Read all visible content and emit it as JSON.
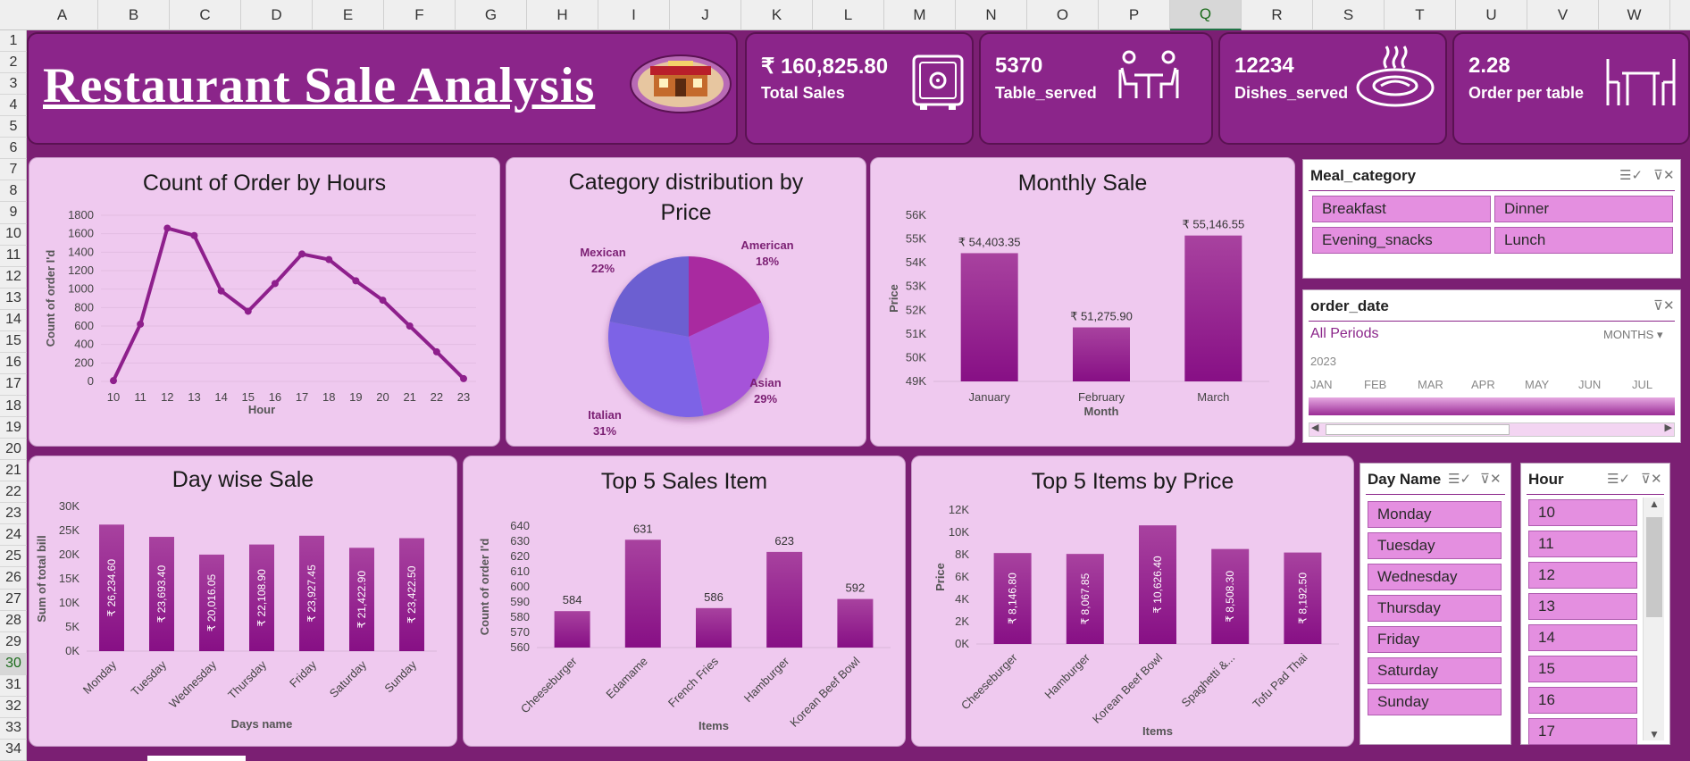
{
  "sheet": {
    "columns": [
      "A",
      "B",
      "C",
      "D",
      "E",
      "F",
      "G",
      "H",
      "I",
      "J",
      "K",
      "L",
      "M",
      "N",
      "O",
      "P",
      "Q",
      "R",
      "S",
      "T",
      "U",
      "V",
      "W"
    ],
    "rows": [
      "1",
      "2",
      "3",
      "4",
      "5",
      "6",
      "7",
      "8",
      "9",
      "10",
      "11",
      "12",
      "13",
      "14",
      "15",
      "16",
      "17",
      "18",
      "19",
      "20",
      "21",
      "22",
      "23",
      "24",
      "25",
      "26",
      "27",
      "28",
      "29",
      "30",
      "31",
      "32",
      "33",
      "34"
    ],
    "selected_column": "Q",
    "selected_row": "30"
  },
  "header": {
    "title": "Restaurant  Sale  Analysis",
    "logo_icon": "restaurant-icon"
  },
  "kpis": [
    {
      "value": "₹ 160,825.80",
      "label": "Total Sales",
      "icon": "safe-icon"
    },
    {
      "value": "5370",
      "label": "Table_served",
      "icon": "dining-table-people-icon"
    },
    {
      "value": "12234",
      "label": "Dishes_served",
      "icon": "hot-dish-icon"
    },
    {
      "value": "2.28",
      "label": "Order per table",
      "icon": "table-chairs-icon"
    }
  ],
  "charts": {
    "hours": {
      "title": "Count of Order by Hours",
      "xlabel": "Hour",
      "ylabel": "Count of order I'd",
      "yticks": [
        "1800",
        "1600",
        "1400",
        "1200",
        "1000",
        "800",
        "600",
        "400",
        "200",
        "0"
      ]
    },
    "category": {
      "title_line1": "Category distribution by",
      "title_line2": "Price",
      "labels": [
        {
          "name": "American",
          "pct": "18%"
        },
        {
          "name": "Asian",
          "pct": "29%"
        },
        {
          "name": "Italian",
          "pct": "31%"
        },
        {
          "name": "Mexican",
          "pct": "22%"
        }
      ]
    },
    "monthly": {
      "title": "Monthly Sale",
      "xlabel": "Month",
      "ylabel": "Price",
      "yticks": [
        "56K",
        "55K",
        "54K",
        "53K",
        "52K",
        "51K",
        "50K",
        "49K"
      ],
      "value_labels": [
        "₹ 54,403.35",
        "₹ 51,275.90",
        "₹ 55,146.55"
      ]
    },
    "daywise": {
      "title": "Day wise Sale",
      "xlabel": "Days name",
      "ylabel": "Sum of total bill",
      "yticks": [
        "30K",
        "25K",
        "20K",
        "15K",
        "10K",
        "5K",
        "0K"
      ],
      "value_labels": [
        "₹ 26,234.60",
        "₹ 23,693.40",
        "₹ 20,016.05",
        "₹ 22,108.90",
        "₹ 23,927.45",
        "₹ 21,422.90",
        "₹ 23,422.50"
      ]
    },
    "top5sales": {
      "title": "Top 5 Sales Item",
      "xlabel": "Items",
      "ylabel": "Count of order I'd",
      "yticks": [
        "640",
        "630",
        "620",
        "610",
        "600",
        "590",
        "580",
        "570",
        "560"
      ],
      "value_labels": [
        "584",
        "631",
        "586",
        "623",
        "592"
      ]
    },
    "top5price": {
      "title": "Top 5 Items by Price",
      "xlabel": "Items",
      "ylabel": "Price",
      "yticks": [
        "12K",
        "10K",
        "8K",
        "6K",
        "4K",
        "2K",
        "0K"
      ],
      "value_labels": [
        "₹ 8,146.80",
        "₹ 8,067.85",
        "₹ 10,626.40",
        "₹ 8,508.30",
        "₹ 8,192.50"
      ]
    }
  },
  "chart_data": [
    {
      "type": "line",
      "title": "Count of Order by Hours",
      "xlabel": "Hour",
      "ylabel": "Count of order I'd",
      "x": [
        10,
        11,
        12,
        13,
        14,
        15,
        16,
        17,
        18,
        19,
        20,
        21,
        22,
        23
      ],
      "y": [
        8,
        620,
        1660,
        1580,
        980,
        760,
        1060,
        1380,
        1320,
        1090,
        880,
        600,
        320,
        30
      ],
      "ylim": [
        0,
        1800
      ],
      "grid": true
    },
    {
      "type": "pie",
      "title": "Category distribution by Price",
      "categories": [
        "American",
        "Asian",
        "Italian",
        "Mexican"
      ],
      "values": [
        18,
        29,
        31,
        22
      ]
    },
    {
      "type": "bar",
      "title": "Monthly Sale",
      "xlabel": "Month",
      "ylabel": "Price",
      "categories": [
        "January",
        "February",
        "March"
      ],
      "values": [
        54403.35,
        51275.9,
        55146.55
      ],
      "ylim": [
        49000,
        56000
      ]
    },
    {
      "type": "bar",
      "title": "Day wise Sale",
      "xlabel": "Days name",
      "ylabel": "Sum of total bill",
      "categories": [
        "Monday",
        "Tuesday",
        "Wednesday",
        "Thursday",
        "Friday",
        "Saturday",
        "Sunday"
      ],
      "values": [
        26234.6,
        23693.4,
        20016.05,
        22108.9,
        23927.45,
        21422.9,
        23422.5
      ],
      "ylim": [
        0,
        30000
      ]
    },
    {
      "type": "bar",
      "title": "Top 5 Sales Item",
      "xlabel": "Items",
      "ylabel": "Count of order I'd",
      "categories": [
        "Cheeseburger",
        "Edamame",
        "French Fries",
        "Hamburger",
        "Korean Beef Bowl"
      ],
      "values": [
        584,
        631,
        586,
        623,
        592
      ],
      "ylim": [
        560,
        640
      ]
    },
    {
      "type": "bar",
      "title": "Top 5 Items by Price",
      "xlabel": "Items",
      "ylabel": "Price",
      "categories": [
        "Cheeseburger",
        "Hamburger",
        "Korean Beef Bowl",
        "Spaghetti &...",
        "Tofu Pad Thai"
      ],
      "values": [
        8146.8,
        8067.85,
        10626.4,
        8508.3,
        8192.5
      ],
      "ylim": [
        0,
        12000
      ]
    }
  ],
  "slicers": {
    "meal": {
      "title": "Meal_category",
      "items": [
        "Breakfast",
        "Dinner",
        "Evening_snacks",
        "Lunch"
      ]
    },
    "order_date": {
      "title": "order_date",
      "all_periods": "All Periods",
      "level": "MONTHS",
      "year": "2023",
      "months": [
        "JAN",
        "FEB",
        "MAR",
        "APR",
        "MAY",
        "JUN",
        "JUL"
      ]
    },
    "day": {
      "title": "Day Name",
      "items": [
        "Monday",
        "Tuesday",
        "Wednesday",
        "Thursday",
        "Friday",
        "Saturday",
        "Sunday"
      ]
    },
    "hour": {
      "title": "Hour",
      "items": [
        "10",
        "11",
        "12",
        "13",
        "14",
        "15",
        "16",
        "17"
      ]
    }
  },
  "colors": {
    "bg": "#7b1f73",
    "panel": "#efc9ef",
    "bar": "#8e1f8c",
    "kpi": "#8b258a",
    "chip": "#e48fe0"
  }
}
